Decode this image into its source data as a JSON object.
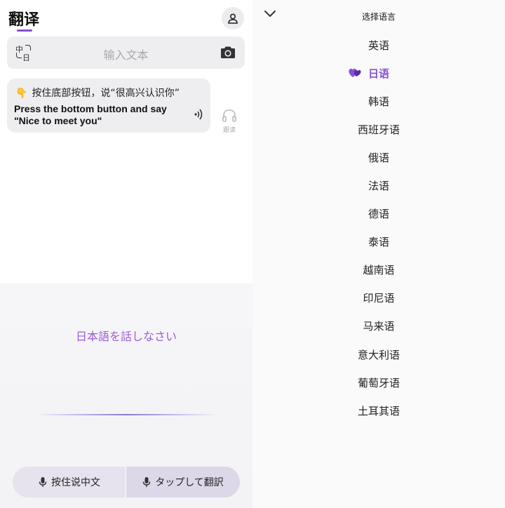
{
  "header": {
    "title": "翻译"
  },
  "input": {
    "placeholder": "输入文本",
    "switch_from": "中",
    "switch_to": "日"
  },
  "hint": {
    "emoji": "👇",
    "instruction": "按住底部按钮，说“很高兴认识你”",
    "english": "Press the bottom button and say \"Nice to meet you\"",
    "listen_label": "跟读"
  },
  "voice": {
    "prompt": "日本語を話しなさい"
  },
  "buttons": {
    "hold_speak_chinese": "按住说中文",
    "tap_translate": "タップして翻訳"
  },
  "language_panel": {
    "title": "选择语言",
    "selected_index": 1,
    "languages": [
      "英语",
      "日语",
      "韩语",
      "西班牙语",
      "俄语",
      "法语",
      "德语",
      "泰语",
      "越南语",
      "印尼语",
      "马来语",
      "意大利语",
      "葡萄牙语",
      "土耳其语"
    ]
  },
  "colors": {
    "accent": "#8b4fd6",
    "prompt": "#9b5bd8"
  }
}
